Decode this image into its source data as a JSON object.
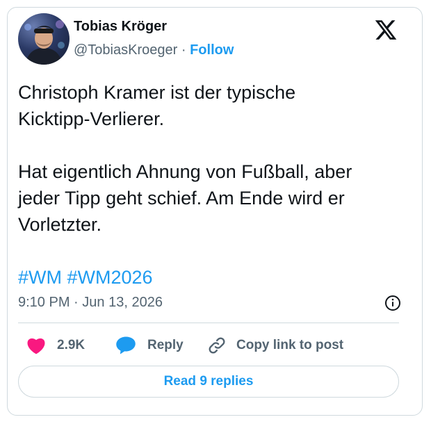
{
  "author": {
    "name": "Tobias Kröger",
    "handle": "@TobiasKroeger",
    "separator": "·",
    "follow_label": "Follow"
  },
  "tweet": {
    "lines_p1": [
      "Christoph Kramer ist der typische",
      "Kicktipp-Verlierer."
    ],
    "lines_p2": [
      "Hat eigentlich Ahnung von Fußball, aber",
      "jeder Tipp geht schief. Am Ende wird er",
      "Vorletzter."
    ],
    "hashtags": [
      "#WM",
      "#WM2026"
    ],
    "time": "9:10 PM",
    "date_separator": "·",
    "date": "Jun 13, 2026"
  },
  "actions": {
    "like_count": "2.9K",
    "reply_label": "Reply",
    "copy_label": "Copy link to post"
  },
  "read_replies_label": "Read 9 replies",
  "colors": {
    "accent": "#1d9bf0",
    "like": "#f91880",
    "muted": "#536471",
    "border": "#cfd9de"
  },
  "icons": [
    "x-logo-icon",
    "heart-icon",
    "reply-bubble-icon",
    "link-icon",
    "info-icon"
  ]
}
